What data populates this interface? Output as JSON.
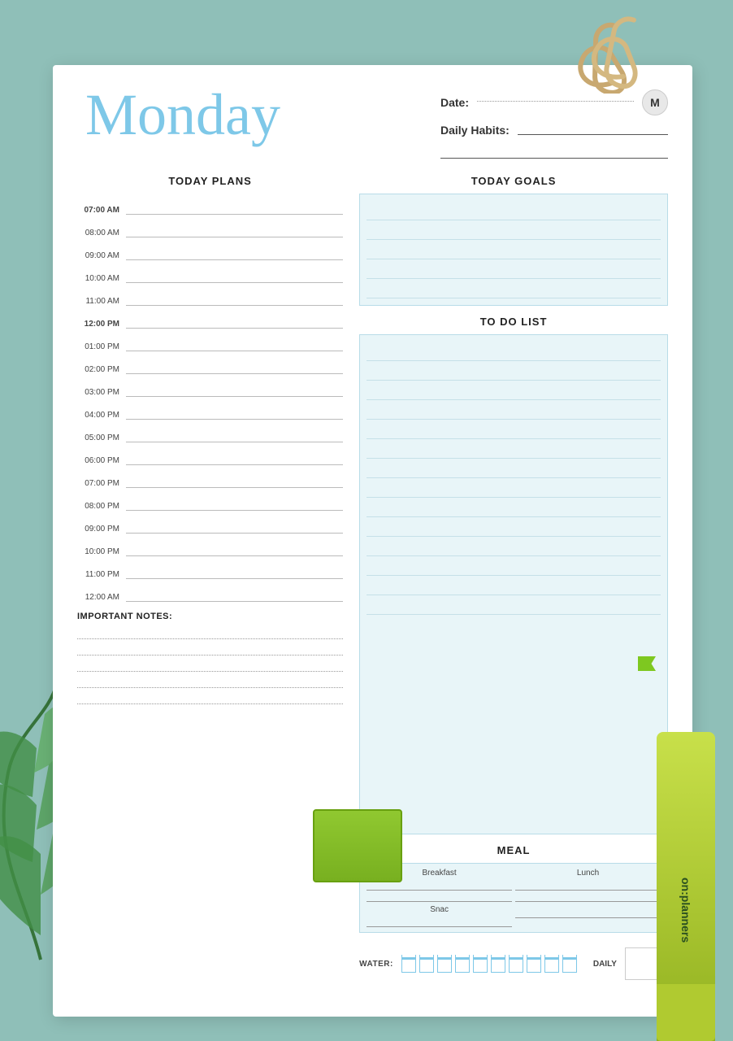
{
  "background": {
    "color": "#8fbfb8"
  },
  "header": {
    "day": "Monday",
    "date_label": "Date:",
    "daily_habits_label": "Daily Habits:",
    "m_badge": "M"
  },
  "today_plans": {
    "title": "TODAY PLANS",
    "time_slots": [
      {
        "time": "07:00 AM",
        "bold": true
      },
      {
        "time": "08:00 AM",
        "bold": false
      },
      {
        "time": "09:00 AM",
        "bold": false
      },
      {
        "time": "10:00 AM",
        "bold": false
      },
      {
        "time": "11:00 AM",
        "bold": false
      },
      {
        "time": "12:00 PM",
        "bold": true
      },
      {
        "time": "01:00 PM",
        "bold": false
      },
      {
        "time": "02:00 PM",
        "bold": false
      },
      {
        "time": "03:00 PM",
        "bold": false
      },
      {
        "time": "04:00 PM",
        "bold": false
      },
      {
        "time": "05:00 PM",
        "bold": false
      },
      {
        "time": "06:00 PM",
        "bold": false
      },
      {
        "time": "07:00 PM",
        "bold": false
      },
      {
        "time": "08:00 PM",
        "bold": false
      },
      {
        "time": "09:00 PM",
        "bold": false
      },
      {
        "time": "10:00 PM",
        "bold": false
      },
      {
        "time": "11:00 PM",
        "bold": false
      },
      {
        "time": "12:00 AM",
        "bold": false
      }
    ]
  },
  "today_goals": {
    "title": "TODAY GOALS",
    "lines_count": 5
  },
  "todo_list": {
    "title": "TO DO LIST",
    "lines_count": 14
  },
  "meal": {
    "title": "MEAL",
    "breakfast_label": "Breakfast",
    "lunch_label": "Lunch",
    "snack_label": "Snac",
    "dinner_label": ""
  },
  "water": {
    "label": "WATER:",
    "glasses_count": 10,
    "daily_label": "DAILY"
  },
  "important_notes": {
    "label": "IMPORTANT NOTES:",
    "lines_count": 5
  },
  "highlighter": {
    "brand": "on:planners",
    "color": "#b8d435"
  }
}
